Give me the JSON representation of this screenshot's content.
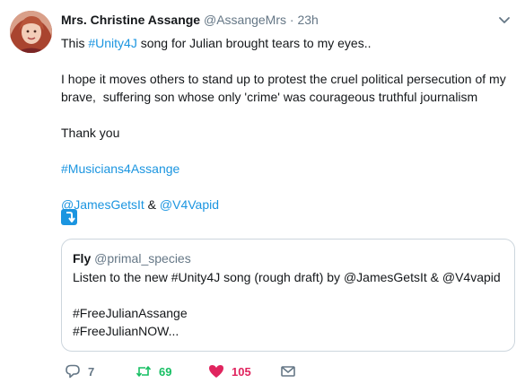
{
  "tweet": {
    "display_name": "Mrs. Christine Assange",
    "handle": "@AssangeMrs",
    "separator": "·",
    "time": "23h",
    "lines": {
      "l1_pre": "This ",
      "l1_tag": "#Unity4J",
      "l1_post": " song for Julian brought tears to my eyes..",
      "l2": "I hope it moves others to stand up to protest the cruel political persecution of my",
      "l3": "brave,  suffering son whose only 'crime' was courageous truthful journalism",
      "thanks": "Thank you",
      "tag_musicians": "#Musicians4Assange",
      "mention1": "@JamesGetsIt",
      "amp": " & ",
      "mention2": "@V4Vapid"
    }
  },
  "quote": {
    "name": "Fly",
    "handle": "@primal_species",
    "line1": "Listen to the new #Unity4J song (rough draft) by @JamesGetsIt & @V4vapid",
    "line2": "#FreeJulianAssange",
    "line3": "#FreeJulianNOW..."
  },
  "actions": {
    "reply_count": "7",
    "retweet_count": "69",
    "like_count": "105"
  },
  "icons": {
    "caret": "chevron-down-icon",
    "badge": "retweet-arrow-icon",
    "reply": "reply-icon",
    "retweet": "retweet-icon",
    "like": "heart-icon",
    "dm": "envelope-icon"
  },
  "colors": {
    "link": "#1b95e0",
    "muted": "#657786",
    "retweet": "#17bf63",
    "like": "#e0245e",
    "border": "#cdd6dd"
  }
}
